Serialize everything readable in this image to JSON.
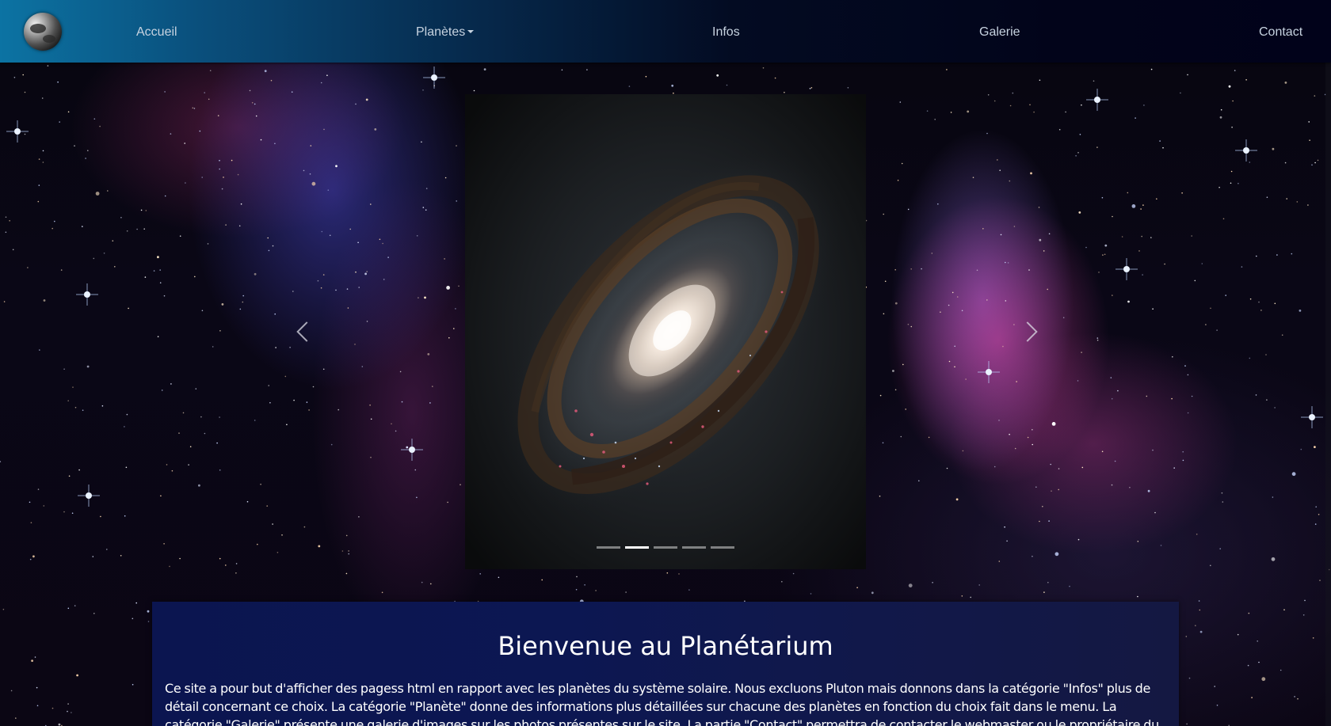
{
  "navbar": {
    "logo_icon": "earth-globe-icon",
    "links": {
      "home": "Accueil",
      "planets": "Planètes",
      "infos": "Infos",
      "gallery": "Galerie",
      "contact": "Contact"
    }
  },
  "carousel": {
    "slide_image": "spiral-galaxy",
    "prev_icon": "chevron-left-icon",
    "next_icon": "chevron-right-icon",
    "slide_count": 5,
    "active_index": 1
  },
  "welcome": {
    "title": "Bienvenue au Planétarium",
    "text": "Ce site a pour but d'afficher des pagess html en rapport avec les planètes du système solaire. Nous excluons Pluton mais donnons dans la catégorie \"Infos\" plus de détail concernant ce choix. La catégorie \"Planète\" donne des informations plus détaillées sur chacune des planètes en fonction du choix fait dans le menu. La catégorie \"Galerie\" présente une galerie d'images sur les photos présentes sur le site. La partie \"Contact\" permettra de contacter le webmaster ou le propriétaire du site en fonction des besoins (Cette partie"
  },
  "colors": {
    "navbar_start": "#0c73a3",
    "navbar_end": "#01021a",
    "nav_text": "#c7d3e0",
    "welcome_bg": "#0b1550"
  }
}
